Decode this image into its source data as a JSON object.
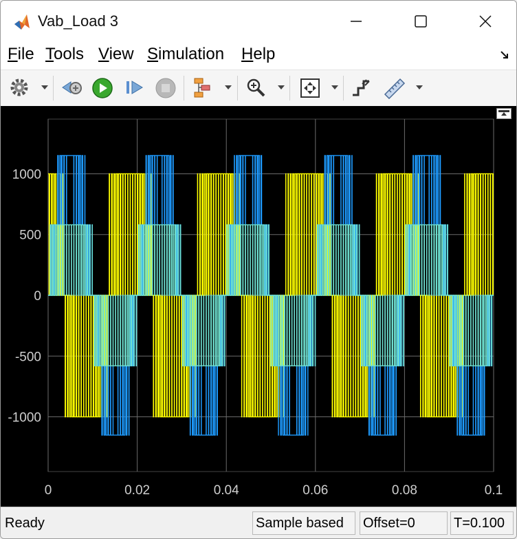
{
  "window": {
    "title": "Vab_Load 3"
  },
  "menu": [
    {
      "label": "File",
      "mnemonic": "F",
      "rest": "ile"
    },
    {
      "label": "Tools",
      "mnemonic": "T",
      "rest": "ools"
    },
    {
      "label": "View",
      "mnemonic": "V",
      "rest": "iew"
    },
    {
      "label": "Simulation",
      "mnemonic": "S",
      "rest": "imulation"
    },
    {
      "label": "Help",
      "mnemonic": "H",
      "rest": "elp"
    }
  ],
  "toolbar": {
    "icons": [
      "gear-icon",
      "step-back-icon",
      "run-icon",
      "step-forward-icon",
      "stop-icon",
      "signal-tree-icon",
      "zoom-in-icon",
      "fit-to-view-icon",
      "cursor-measure-icon",
      "ruler-icon"
    ]
  },
  "colors": {
    "yellow": "#ffff00",
    "blue": "#1e9bff",
    "cyan": "#6ee0d0",
    "grid": "#6b6b6b",
    "tick": "#cfcfcf"
  },
  "chart_data": {
    "type": "line",
    "title": "",
    "xlabel": "",
    "ylabel": "",
    "xlim": [
      0,
      0.1
    ],
    "ylim": [
      -1450,
      1450
    ],
    "xticks": [
      "0",
      "0.02",
      "0.04",
      "0.06",
      "0.08",
      "0.1"
    ],
    "xtick_values": [
      0,
      0.02,
      0.04,
      0.06,
      0.08,
      0.1
    ],
    "yticks": [
      "-1000",
      "-500",
      "0",
      "500",
      "1000"
    ],
    "ytick_values": [
      -1000,
      -500,
      0,
      500,
      1000
    ],
    "grid": true,
    "fundamental_period": 0.02,
    "pwm_carrier_period": 0.00055,
    "series": [
      {
        "color": "#ffff00",
        "levels": [
          0,
          1000,
          -1000
        ],
        "phase_deg": 240
      },
      {
        "color": "#6ee0d0",
        "levels": [
          0,
          580,
          -580
        ],
        "phase_deg": 0
      },
      {
        "color": "#1e9bff",
        "levels": [
          0,
          580,
          1150,
          -580,
          -1150
        ],
        "phase_deg": 0
      }
    ]
  },
  "status": {
    "ready": "Ready",
    "mode": "Sample based",
    "offset": "Offset=0",
    "time": "T=0.100"
  }
}
